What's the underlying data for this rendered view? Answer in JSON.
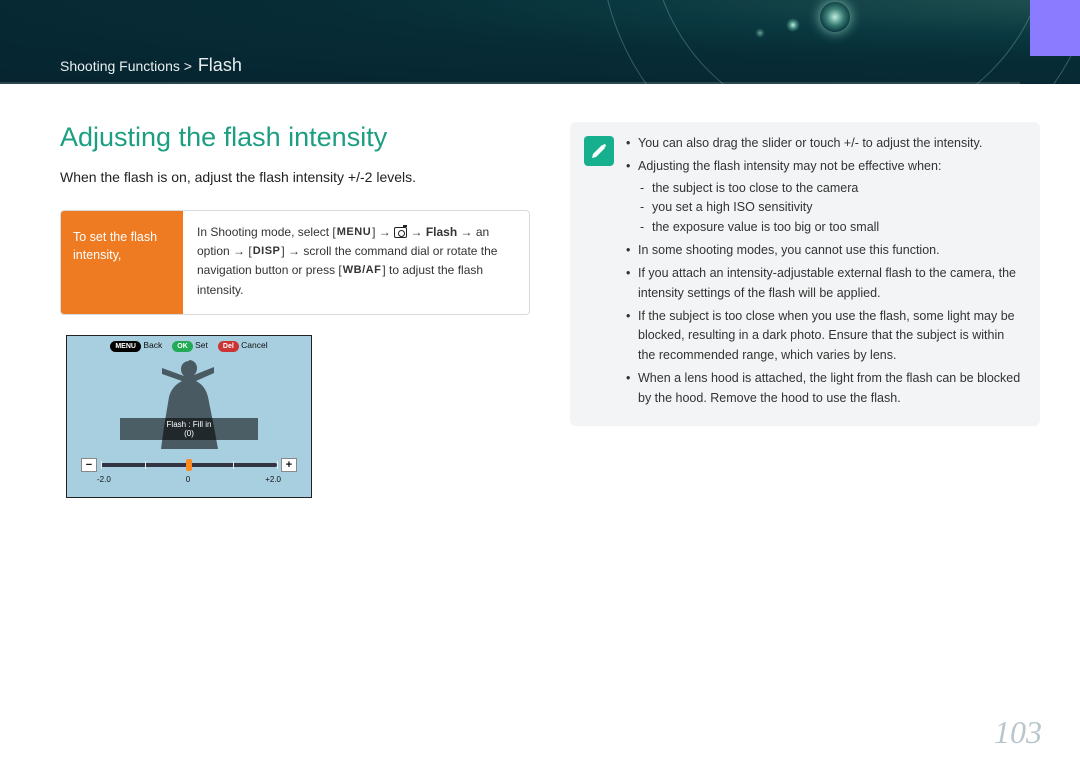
{
  "breadcrumb": {
    "path": "Shooting Functions >",
    "section": "Flash"
  },
  "heading": "Adjusting the flash intensity",
  "lead": "When the flash is on, adjust the flash intensity +/-2 levels.",
  "setbox": {
    "label": "To set the flash intensity,",
    "text_pre": "In Shooting mode, select [",
    "menu": "MENU",
    "text_1": "] → ",
    "text_2": " → ",
    "flash_bold": "Flash",
    "text_3": " → an option → [",
    "disp": "DISP",
    "text_4": "] → scroll the command dial or rotate the navigation button or press [",
    "wbaf": "WB/AF",
    "text_5": "] to adjust the flash intensity."
  },
  "lcd": {
    "back_btn": "MENU",
    "back_lbl": "Back",
    "set_btn": "OK",
    "set_lbl": "Set",
    "cancel_btn": "Del",
    "cancel_lbl": "Cancel",
    "strip_title": "Flash : Fill in",
    "strip_val": "(0)",
    "minus": "−",
    "plus": "+",
    "scale_lo": "-2.0",
    "scale_mid": "0",
    "scale_hi": "+2.0"
  },
  "notes": {
    "n1": "You can also drag the slider or touch +/- to adjust the intensity.",
    "n2": "Adjusting the flash intensity may not be effective when:",
    "n2a": "the subject is too close to the camera",
    "n2b": "you set a high ISO sensitivity",
    "n2c": "the exposure value is too big or too small",
    "n3": "In some shooting modes, you cannot use this function.",
    "n4": "If you attach an intensity-adjustable external flash to the camera, the intensity settings of the flash will be applied.",
    "n5": "If the subject is too close when you use the flash, some light may be blocked, resulting in a dark photo. Ensure that the subject is within the recommended range, which varies by lens.",
    "n6": "When a lens hood is attached, the light from the flash can be blocked by the hood. Remove the hood to use the flash."
  },
  "page_number": "103"
}
